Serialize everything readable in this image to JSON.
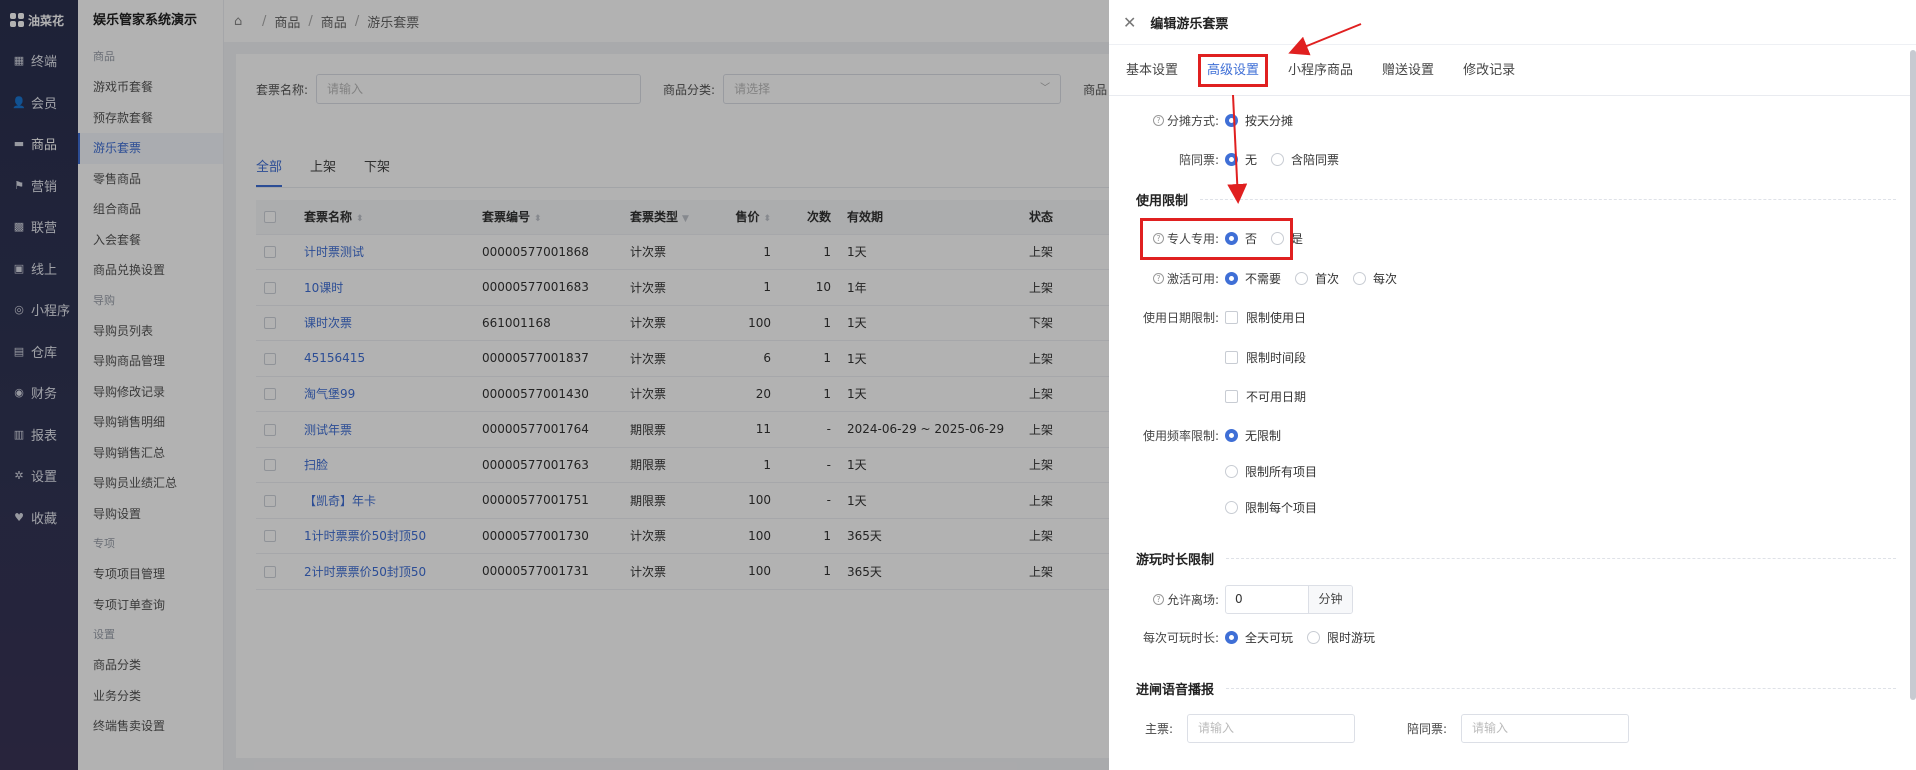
{
  "app": {
    "logo_text": "油菜花"
  },
  "rail": {
    "items": [
      {
        "label": "终端",
        "icon": "terminal-icon",
        "glyph": "▦"
      },
      {
        "label": "会员",
        "icon": "user-icon",
        "glyph": "👤"
      },
      {
        "label": "商品",
        "icon": "card-icon",
        "glyph": "▬"
      },
      {
        "label": "营销",
        "icon": "flag-icon",
        "glyph": "⚑"
      },
      {
        "label": "联营",
        "icon": "grid-icon",
        "glyph": "▩"
      },
      {
        "label": "线上",
        "icon": "window-icon",
        "glyph": "▣"
      },
      {
        "label": "小程序",
        "icon": "miniapp-icon",
        "glyph": "◎"
      },
      {
        "label": "仓库",
        "icon": "warehouse-icon",
        "glyph": "▤"
      },
      {
        "label": "财务",
        "icon": "finance-icon",
        "glyph": "◉"
      },
      {
        "label": "报表",
        "icon": "report-icon",
        "glyph": "▥"
      },
      {
        "label": "设置",
        "icon": "settings-icon",
        "glyph": "✲"
      },
      {
        "label": "收藏",
        "icon": "heart-icon",
        "glyph": "♥"
      }
    ]
  },
  "submenu": {
    "title": "娱乐管家系统演示",
    "groups": [
      {
        "name": "商品",
        "items": [
          "游戏币套餐",
          "预存款套餐",
          "游乐套票",
          "零售商品",
          "组合商品",
          "入会套餐",
          "商品兑换设置"
        ]
      },
      {
        "name": "导购",
        "items": [
          "导购员列表",
          "导购商品管理",
          "导购修改记录",
          "导购销售明细",
          "导购销售汇总",
          "导购员业绩汇总",
          "导购设置"
        ]
      },
      {
        "name": "专项",
        "items": [
          "专项项目管理",
          "专项订单查询"
        ]
      },
      {
        "name": "设置",
        "items": [
          "商品分类",
          "业务分类",
          "终端售卖设置"
        ]
      }
    ],
    "active": "游乐套票"
  },
  "breadcrumb": [
    "商品",
    "商品",
    "游乐套票"
  ],
  "filter": {
    "name_label": "套票名称:",
    "name_placeholder": "请输入",
    "cat_label": "商品分类:",
    "cat_placeholder": "请选择",
    "third_label": "商品"
  },
  "list_tabs": [
    "全部",
    "上架",
    "下架"
  ],
  "table": {
    "headers": [
      "套票名称",
      "套票编号",
      "套票类型",
      "售价",
      "次数",
      "有效期",
      "状态"
    ],
    "rows": [
      [
        "计时票测试",
        "00000577001868",
        "计次票",
        "1",
        "1",
        "1天",
        "上架"
      ],
      [
        "10课时",
        "00000577001683",
        "计次票",
        "1",
        "10",
        "1年",
        "上架"
      ],
      [
        "课时次票",
        "661001168",
        "计次票",
        "100",
        "1",
        "1天",
        "下架"
      ],
      [
        "45156415",
        "00000577001837",
        "计次票",
        "6",
        "1",
        "1天",
        "上架"
      ],
      [
        "淘气堡99",
        "00000577001430",
        "计次票",
        "20",
        "1",
        "1天",
        "上架"
      ],
      [
        "测试年票",
        "00000577001764",
        "期限票",
        "11",
        "-",
        "2024-06-29 ~ 2025-06-29",
        "上架"
      ],
      [
        "扫脸",
        "00000577001763",
        "期限票",
        "1",
        "-",
        "1天",
        "上架"
      ],
      [
        "【凯奇】年卡",
        "00000577001751",
        "期限票",
        "100",
        "-",
        "1天",
        "上架"
      ],
      [
        "1计时票票价50封顶50",
        "00000577001730",
        "计次票",
        "100",
        "1",
        "365天",
        "上架"
      ],
      [
        "2计时票票价50封顶50",
        "00000577001731",
        "计次票",
        "100",
        "1",
        "365天",
        "上架"
      ]
    ]
  },
  "drawer": {
    "title": "编辑游乐套票",
    "tabs": [
      "基本设置",
      "高级设置",
      "小程序商品",
      "赠送设置",
      "修改记录"
    ],
    "active_tab": "高级设置",
    "fields": {
      "split_label": "分摊方式:",
      "split_opt": "按天分摊",
      "companion_label": "陪同票:",
      "companion_opts": [
        "无",
        "含陪同票"
      ],
      "sec_usage": "使用限制",
      "exclusive_label": "专人专用:",
      "exclusive_opts": [
        "否",
        "是"
      ],
      "activate_label": "激活可用:",
      "activate_opts": [
        "不需要",
        "首次",
        "每次"
      ],
      "date_label": "使用日期限制:",
      "date_opts": [
        "限制使用日",
        "限制时间段",
        "不可用日期"
      ],
      "freq_label": "使用频率限制:",
      "freq_opts": [
        "无限制",
        "限制所有项目",
        "限制每个项目"
      ],
      "sec_play": "游玩时长限制",
      "leave_label": "允许离场:",
      "leave_value": "0",
      "leave_unit": "分钟",
      "duration_label": "每次可玩时长:",
      "duration_opts": [
        "全天可玩",
        "限时游玩"
      ],
      "sec_voice": "进闸语音播报",
      "main_label": "主票:",
      "main_placeholder": "请输入",
      "comp_label": "陪同票:",
      "comp_placeholder": "请输入"
    }
  },
  "colors": {
    "accent": "#3f6fd6",
    "annotation": "#e02020",
    "rail": "#2b3150"
  }
}
